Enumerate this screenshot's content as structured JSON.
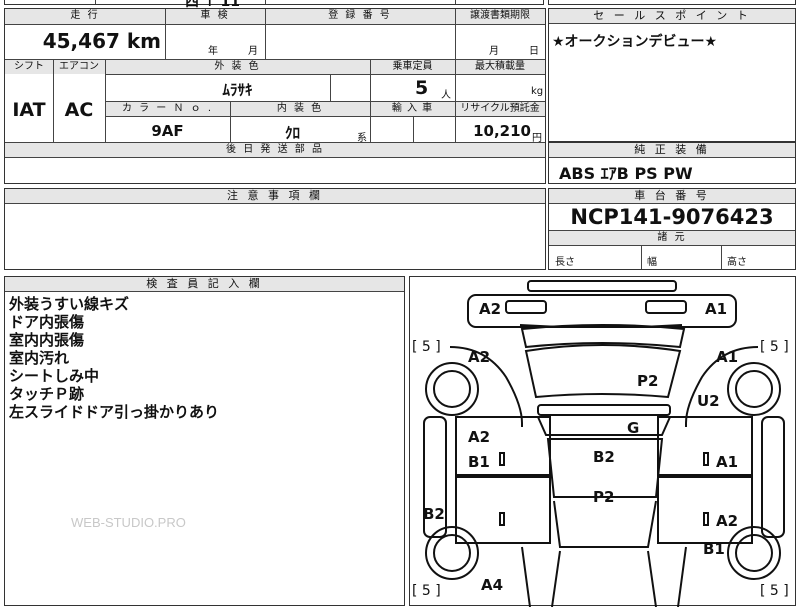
{
  "top_strip": {
    "partial_text": "西 ↑ 11"
  },
  "main_table": {
    "mileage_label": "走 行",
    "mileage_value": "45,467 km",
    "inspection_label": "車 検",
    "inspection_year": "年",
    "inspection_month": "月",
    "registration_label": "登 録 番 号",
    "transfer_label": "譲渡書類期限",
    "transfer_month": "月",
    "transfer_day": "日",
    "shift_label": "シフト",
    "aircon_label": "エアコン",
    "exterior_color_label": "外 装 色",
    "capacity_label": "乗車定員",
    "max_load_label": "最大積載量",
    "shift_value": "IAT",
    "aircon_value": "AC",
    "exterior_color_value": "ﾑﾗｻｷ",
    "capacity_value": "5",
    "capacity_unit": "人",
    "load_unit": "kg",
    "color_no_label": "カ ラ ー Ｎ ｏ .",
    "interior_color_label": "内 装 色",
    "import_label": "輸 入 車",
    "recycle_label": "リサイクル預託金",
    "color_no_value": "9AF",
    "interior_color_value": "ｸﾛ",
    "interior_suffix": "系",
    "recycle_value": "10,210",
    "recycle_unit": "円",
    "parts_label": "後 日 発 送 部 品"
  },
  "sales_point": {
    "label": "セ ー ル ス ポ イ ン ト",
    "text": "★オークションデビュー★"
  },
  "equipment": {
    "label": "純 正 装 備",
    "value": "ABS ｴｱB PS PW"
  },
  "caution": {
    "label": "注 意 事 項 欄"
  },
  "chassis": {
    "label": "車 台 番 号",
    "value": "NCP141-9076423",
    "dims_label": "諸 元",
    "length": "長さ",
    "width": "幅",
    "height": "高さ"
  },
  "inspector": {
    "label": "検 査 員 記 入 欄",
    "notes": [
      "外装うすい線キズ",
      "ドア内張傷",
      "室内内張傷",
      "室内汚れ",
      "シートしみ中",
      "タッチＰ跡",
      "左スライドドア引っ掛かりあり"
    ]
  },
  "diagram": {
    "tires": [
      "[ 5 ]",
      "[ 5 ]",
      "[ 5 ]",
      "[ 5 ]"
    ],
    "marks": [
      "A2",
      "A1",
      "A2",
      "A1",
      "P2",
      "U2",
      "G",
      "A2",
      "B1",
      "B2",
      "A1",
      "P2",
      "B2",
      "A2",
      "B1",
      "A4"
    ]
  },
  "watermark": "WEB-STUDIO.PRO"
}
